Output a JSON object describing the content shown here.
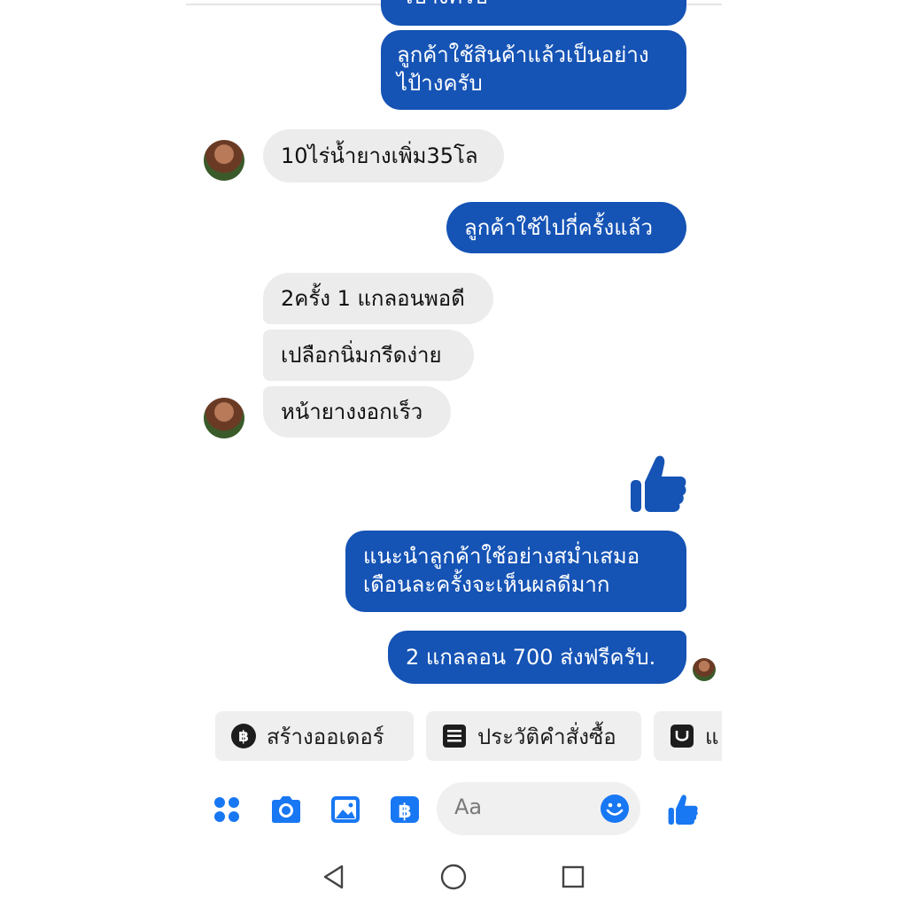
{
  "messages": {
    "m0_partial": "ไป้างครับ",
    "m1_line1": "ลูกค้าใช้สินค้าแล้วเป็นอย่าง",
    "m1_line2": "ไป้างครับ",
    "m2": "10ไร่น้ำยางเพิ่ม35โล",
    "m3": "ลูกค้าใช้ไปกี่ครั้งแล้ว",
    "m4": "2ครั้ง 1 แกลอนพอดี",
    "m5": "เปลือกนิ่มกรีดง่าย",
    "m6": "หน้ายางงอกเร็ว",
    "m7_line1": "แนะนำลูกค้าใช้อย่างสม่ำเสมอ",
    "m7_line2": "เดือนละครั้งจะเห็นผลดีมาก",
    "m8": "2 แกลลอน 700 ส่งฟรีครับ."
  },
  "quick_replies": [
    {
      "label": "สร้างออเดอร์",
      "icon": "baht-icon"
    },
    {
      "label": "ประวัติคำสั่งซื้อ",
      "icon": "receipt-icon"
    },
    {
      "label": "แ",
      "icon": "shop-icon"
    }
  ],
  "composer": {
    "placeholder": "Aa",
    "tools": [
      "apps-icon",
      "camera-icon",
      "gallery-icon",
      "baht-payment-icon"
    ],
    "emoji_icon": "smiley-icon",
    "like_icon": "thumbs-up-icon"
  },
  "nav": [
    "back-icon",
    "home-icon",
    "recents-icon"
  ],
  "colors": {
    "outgoing_bubble": "#1553b5",
    "incoming_bubble": "#ececec",
    "accent": "#1877f2"
  }
}
